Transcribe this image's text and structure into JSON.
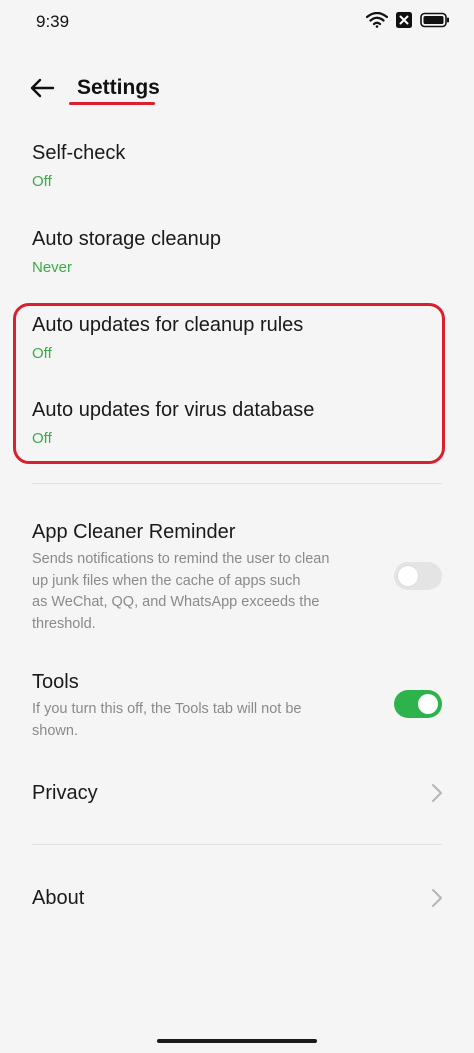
{
  "status_bar": {
    "time": "9:39"
  },
  "header": {
    "title": "Settings"
  },
  "items": {
    "self_check": {
      "title": "Self-check",
      "value": "Off"
    },
    "auto_storage": {
      "title": "Auto storage cleanup",
      "value": "Never"
    },
    "auto_rules": {
      "title": "Auto updates for cleanup rules",
      "value": "Off"
    },
    "auto_virus": {
      "title": "Auto updates for virus database",
      "value": "Off"
    },
    "reminder": {
      "title": "App Cleaner Reminder",
      "desc_lines": [
        "Sends notifications to remind the user to clean",
        "up junk files when the cache of apps such",
        "as WeChat, QQ, and WhatsApp exceeds the",
        "threshold."
      ],
      "enabled": false
    },
    "tools": {
      "title": "Tools",
      "desc_lines": [
        "If you turn this off, the Tools tab will not be",
        "shown."
      ],
      "enabled": true
    },
    "privacy": {
      "title": "Privacy"
    },
    "about": {
      "title": "About"
    }
  },
  "colors": {
    "accent_green": "#3aaa4a",
    "highlight_red": "#d8202f",
    "toggle_on": "#2eb24c"
  },
  "icons": {
    "back": "arrow-left-icon",
    "wifi": "wifi-icon",
    "close": "close-box-icon",
    "battery": "battery-icon",
    "chevron": "chevron-right-icon"
  }
}
